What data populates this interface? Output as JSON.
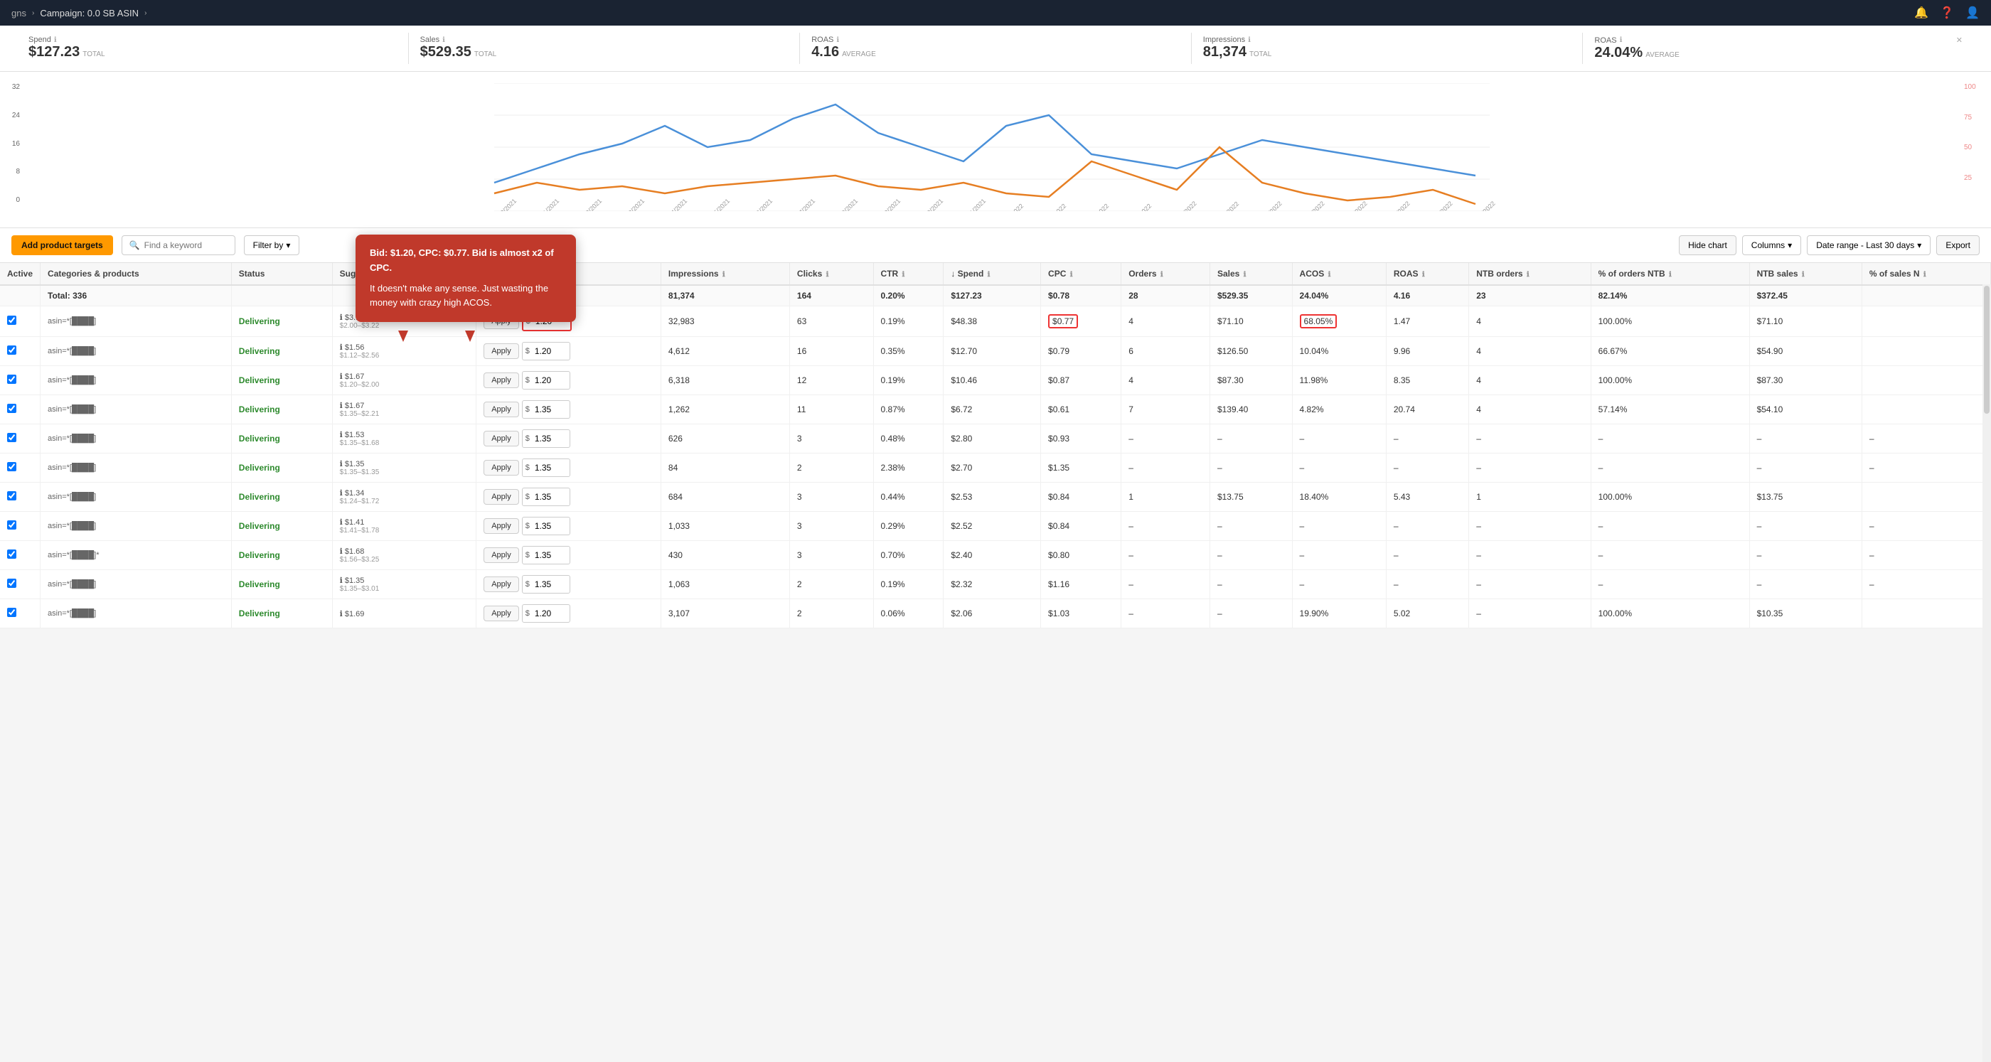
{
  "nav": {
    "breadcrumb1": "gns",
    "breadcrumb2": "Campaign: 0.0 SB ASIN",
    "icons": [
      "bell-icon",
      "help-icon",
      "user-icon"
    ]
  },
  "stats": [
    {
      "label": "Spend",
      "value": "$127.23",
      "sub": "TOTAL"
    },
    {
      "label": "Sales",
      "value": "$529.35",
      "sub": "TOTAL"
    },
    {
      "label": "ROAS",
      "value": "4.16",
      "sub": "AVERAGE"
    },
    {
      "label": "Impressions",
      "value": "81,374",
      "sub": "TOTAL"
    },
    {
      "label": "ROAS",
      "value": "24.04%",
      "sub": "AVERAGE"
    }
  ],
  "chart": {
    "y_left_labels": [
      "32",
      "24",
      "16",
      "8",
      "0"
    ],
    "y_right_labels": [
      "100",
      "75",
      "50",
      "25",
      ""
    ],
    "hide_chart_label": "Hide chart"
  },
  "toolbar": {
    "add_button": "Add product targets",
    "search_placeholder": "Find a keyword",
    "filter_label": "Filter by",
    "columns_label": "Columns",
    "date_range_label": "Date range - Last 30 days",
    "export_label": "Export"
  },
  "annotation": {
    "title": "Bid: $1.20, CPC: $0.77. Bid is almost x2 of CPC.",
    "body": "It doesn't make any sense. Just wasting the money with crazy high ACOS."
  },
  "table": {
    "columns": [
      "Active",
      "Categories & products",
      "Status",
      "Suggested bid",
      "Bid",
      "Impressions",
      "Clicks",
      "CTR",
      "Spend",
      "CPC",
      "Orders",
      "Sales",
      "ACOS",
      "ROAS",
      "NTB orders",
      "% of orders NTB",
      "NTB sales",
      "% of sales N"
    ],
    "total": {
      "count": "Total: 336",
      "impressions": "81,374",
      "clicks": "164",
      "ctr": "0.20%",
      "spend": "$127.23",
      "cpc": "$0.78",
      "orders": "28",
      "sales": "$529.35",
      "acos": "24.04%",
      "roas": "4.16",
      "ntb_orders": "23",
      "pct_orders_ntb": "82.14%",
      "ntb_sales": "$372.45",
      "pct_sales_n": ""
    },
    "rows": [
      {
        "active": true,
        "asin": "asin=*[redacted]",
        "status": "Delivering",
        "suggested_bid": "$3.12",
        "suggested_range": "$2.00–$3.22",
        "bid": "1.20",
        "bid_highlight": true,
        "impressions": "32,983",
        "clicks": "63",
        "ctr": "0.19%",
        "spend": "$48.38",
        "cpc": "$0.77",
        "cpc_highlight": true,
        "orders": "4",
        "sales": "$71.10",
        "acos": "68.05%",
        "acos_highlight": true,
        "roas": "1.47",
        "ntb_orders": "4",
        "pct_orders_ntb": "100.00%",
        "ntb_sales": "$71.10",
        "apply_bid": "1.20"
      },
      {
        "active": true,
        "asin": "asin=*[redacted]",
        "status": "Delivering",
        "suggested_bid": "$1.56",
        "suggested_range": "$1.12–$2.56",
        "bid": "1.20",
        "impressions": "4,612",
        "clicks": "16",
        "ctr": "0.35%",
        "spend": "$12.70",
        "cpc": "$0.79",
        "orders": "6",
        "sales": "$126.50",
        "acos": "10.04%",
        "roas": "9.96",
        "ntb_orders": "4",
        "pct_orders_ntb": "66.67%",
        "ntb_sales": "$54.90",
        "apply_bid": "1.20"
      },
      {
        "active": true,
        "asin": "asin=*[redacted]",
        "status": "Delivering",
        "suggested_bid": "$1.67",
        "suggested_range": "$1.20–$2.00",
        "bid": "1.20",
        "impressions": "6,318",
        "clicks": "12",
        "ctr": "0.19%",
        "spend": "$10.46",
        "cpc": "$0.87",
        "orders": "4",
        "sales": "$87.30",
        "acos": "11.98%",
        "roas": "8.35",
        "ntb_orders": "4",
        "pct_orders_ntb": "100.00%",
        "ntb_sales": "$87.30",
        "apply_bid": "1.20"
      },
      {
        "active": true,
        "asin": "asin=*[redacted]",
        "status": "Delivering",
        "suggested_bid": "$1.67",
        "suggested_range": "$1.35–$2.21",
        "bid": "1.35",
        "impressions": "1,262",
        "clicks": "11",
        "ctr": "0.87%",
        "spend": "$6.72",
        "cpc": "$0.61",
        "orders": "7",
        "sales": "$139.40",
        "acos": "4.82%",
        "roas": "20.74",
        "ntb_orders": "4",
        "pct_orders_ntb": "57.14%",
        "ntb_sales": "$54.10",
        "apply_bid": "1.35"
      },
      {
        "active": true,
        "asin": "asin=*[redacted]",
        "status": "Delivering",
        "suggested_bid": "$1.53",
        "suggested_range": "$1.35–$1.68",
        "bid": "1.35",
        "impressions": "626",
        "clicks": "3",
        "ctr": "0.48%",
        "spend": "$2.80",
        "cpc": "$0.93",
        "orders": "–",
        "sales": "–",
        "acos": "–",
        "roas": "–",
        "ntb_orders": "–",
        "pct_orders_ntb": "–",
        "ntb_sales": "–",
        "apply_bid": "1.35"
      },
      {
        "active": true,
        "asin": "asin=*[redacted]",
        "status": "Delivering",
        "suggested_bid": "$1.35",
        "suggested_range": "$1.35–$1.35",
        "bid": "1.35",
        "impressions": "84",
        "clicks": "2",
        "ctr": "2.38%",
        "spend": "$2.70",
        "cpc": "$1.35",
        "orders": "–",
        "sales": "–",
        "acos": "–",
        "roas": "–",
        "ntb_orders": "–",
        "pct_orders_ntb": "–",
        "ntb_sales": "–",
        "apply_bid": "1.35"
      },
      {
        "active": true,
        "asin": "asin=*[redacted]",
        "status": "Delivering",
        "suggested_bid": "$1.34",
        "suggested_range": "$1.24–$1.72",
        "bid": "1.35",
        "impressions": "684",
        "clicks": "3",
        "ctr": "0.44%",
        "spend": "$2.53",
        "cpc": "$0.84",
        "orders": "1",
        "sales": "$13.75",
        "acos": "18.40%",
        "roas": "5.43",
        "ntb_orders": "1",
        "pct_orders_ntb": "100.00%",
        "ntb_sales": "$13.75",
        "apply_bid": "1.35"
      },
      {
        "active": true,
        "asin": "asin=*[redacted]",
        "status": "Delivering",
        "suggested_bid": "$1.41",
        "suggested_range": "$1.41–$1.78",
        "bid": "1.35",
        "impressions": "1,033",
        "clicks": "3",
        "ctr": "0.29%",
        "spend": "$2.52",
        "cpc": "$0.84",
        "orders": "–",
        "sales": "–",
        "acos": "–",
        "roas": "–",
        "ntb_orders": "–",
        "pct_orders_ntb": "–",
        "ntb_sales": "–",
        "apply_bid": "1.35"
      },
      {
        "active": true,
        "asin": "asin=*[redacted]",
        "status": "Delivering",
        "suggested_bid": "$1.68",
        "suggested_range": "$1.56–$3.25",
        "bid": "1.35",
        "impressions": "430",
        "clicks": "3",
        "ctr": "0.70%",
        "spend": "$2.40",
        "cpc": "$0.80",
        "orders": "–",
        "sales": "–",
        "acos": "–",
        "roas": "–",
        "ntb_orders": "–",
        "pct_orders_ntb": "–",
        "ntb_sales": "–",
        "apply_bid": "1.35"
      },
      {
        "active": true,
        "asin": "asin=*[redacted]",
        "status": "Delivering",
        "suggested_bid": "$1.35",
        "suggested_range": "$1.35–$3.01",
        "bid": "1.35",
        "impressions": "1,063",
        "clicks": "2",
        "ctr": "0.19%",
        "spend": "$2.32",
        "cpc": "$1.16",
        "orders": "–",
        "sales": "–",
        "acos": "–",
        "roas": "–",
        "ntb_orders": "–",
        "pct_orders_ntb": "–",
        "ntb_sales": "–",
        "apply_bid": "1.35"
      },
      {
        "active": true,
        "asin": "asin=*[redacted]",
        "status": "Delivering",
        "suggested_bid": "$1.69",
        "suggested_range": "",
        "bid": "1.20",
        "impressions": "3,107",
        "clicks": "2",
        "ctr": "0.06%",
        "spend": "$2.06",
        "cpc": "$1.03",
        "orders": "–",
        "sales": "–",
        "acos": "19.90%",
        "roas": "5.02",
        "ntb_orders": "–",
        "pct_orders_ntb": "100.00%",
        "ntb_sales": "$10.35",
        "apply_bid": "1.20"
      }
    ],
    "apply_label": "Apply"
  },
  "colors": {
    "delivering": "#2d8a2d",
    "accent_orange": "#f90",
    "annotation_bg": "#c0392b",
    "highlight_red": "#e33333",
    "nav_bg": "#1a2332"
  }
}
